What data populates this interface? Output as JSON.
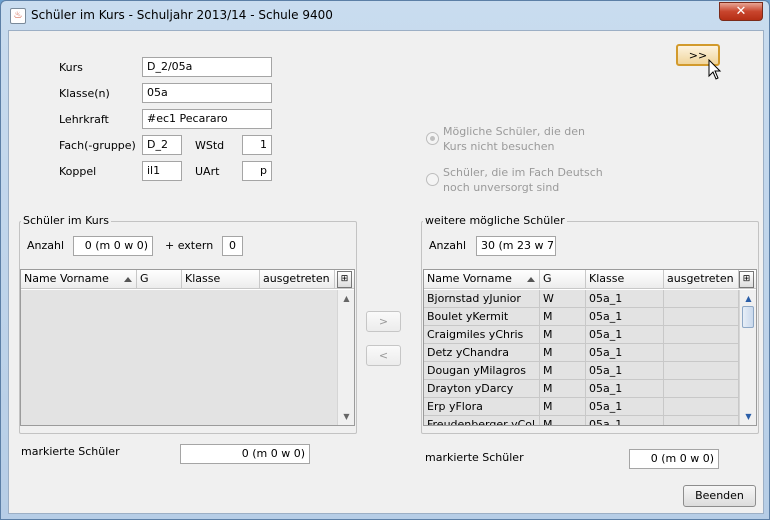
{
  "window": {
    "title": "Schüler im Kurs - Schuljahr 2013/14 - Schule 9400",
    "close_glyph": "✕",
    "icon_glyph": "♨"
  },
  "form": {
    "kurs_label": "Kurs",
    "kurs_value": "D_2/05a",
    "klasse_label": "Klasse(n)",
    "klasse_value": "05a",
    "lehrkraft_label": "Lehrkraft",
    "lehrkraft_value": "#ec1 Pecararo",
    "fach_label": "Fach(-gruppe)",
    "fach_value": "D_2",
    "wstd_label": "WStd",
    "wstd_value": "1",
    "koppel_label": "Koppel",
    "koppel_value": "il1",
    "uart_label": "UArt",
    "uart_value": "p"
  },
  "expand_button": ">>",
  "options": {
    "option1": "Mögliche Schüler, die den Kurs nicht besuchen",
    "option1_line1": "Mögliche Schüler, die den",
    "option1_line2": "Kurs nicht besuchen",
    "option2_line1": "Schüler, die im Fach Deutsch",
    "option2_line2": "noch unversorgt sind",
    "selected": "option1"
  },
  "left_panel": {
    "title": "Schüler im Kurs",
    "anzahl_label": "Anzahl",
    "anzahl_value": "0 (m 0 w 0)",
    "extern_label": "+  extern",
    "extern_value": "0",
    "columns": [
      "Name Vorname",
      "G",
      "Klasse",
      "ausgetreten"
    ],
    "rows": [],
    "marked_label": "markierte Schüler",
    "marked_value": "0 (m 0 w 0)"
  },
  "move": {
    "right": ">",
    "left": "<"
  },
  "right_panel": {
    "title": "weitere mögliche Schüler",
    "anzahl_label": "Anzahl",
    "anzahl_value": "30 (m 23 w 7)",
    "columns": [
      "Name Vorname",
      "G",
      "Klasse",
      "ausgetreten"
    ],
    "rows": [
      {
        "name": "Bjornstad yJunior",
        "g": "W",
        "klasse": "05a_1",
        "ausgetreten": ""
      },
      {
        "name": "Boulet yKermit",
        "g": "M",
        "klasse": "05a_1",
        "ausgetreten": ""
      },
      {
        "name": "Craigmiles yChris",
        "g": "M",
        "klasse": "05a_1",
        "ausgetreten": ""
      },
      {
        "name": "Detz yChandra",
        "g": "M",
        "klasse": "05a_1",
        "ausgetreten": ""
      },
      {
        "name": "Dougan yMilagros",
        "g": "M",
        "klasse": "05a_1",
        "ausgetreten": ""
      },
      {
        "name": "Drayton yDarcy",
        "g": "M",
        "klasse": "05a_1",
        "ausgetreten": ""
      },
      {
        "name": "Erp yFlora",
        "g": "M",
        "klasse": "05a_1",
        "ausgetreten": ""
      },
      {
        "name": "Freudenberger yCol",
        "g": "M",
        "klasse": "05a_1",
        "ausgetreten": ""
      }
    ],
    "marked_label": "markierte Schüler",
    "marked_value": "0 (m 0 w 0)"
  },
  "close_button": "Beenden",
  "icons": {
    "sort": "sort-ascending-icon",
    "column_chooser": "column-chooser-icon",
    "scroll_up": "scroll-up-icon",
    "scroll_down": "scroll-down-icon",
    "cursor": "mouse-pointer-icon"
  },
  "colors": {
    "title_bg": "#b6cde6",
    "close_button": "#c8452d",
    "highlight_button_border": "#d29a2c"
  }
}
